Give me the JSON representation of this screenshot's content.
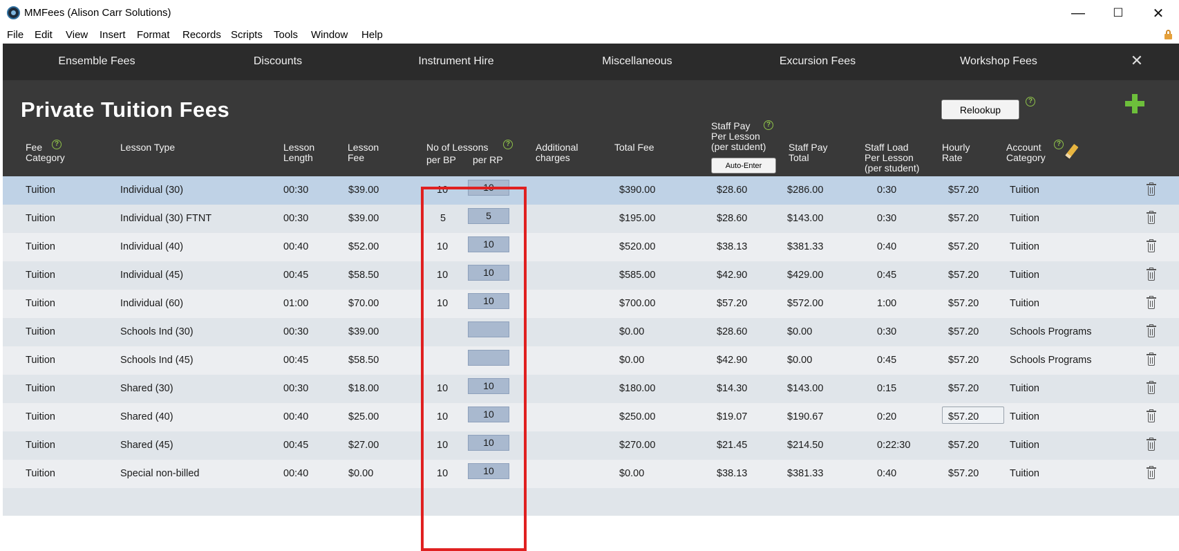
{
  "window": {
    "title": "MMFees (Alison Carr Solutions)",
    "minimize": "—",
    "maximize": "☐",
    "close": "✕"
  },
  "menu": [
    "File",
    "Edit",
    "View",
    "Insert",
    "Format",
    "Records",
    "Scripts",
    "Tools",
    "Window",
    "Help"
  ],
  "tabs": [
    "Ensemble Fees",
    "Discounts",
    "Instrument Hire",
    "Miscellaneous",
    "Excursion Fees",
    "Workshop Fees"
  ],
  "tab_close": "✕",
  "page_title": "Private Tuition Fees",
  "relookup_label": "Relookup",
  "help_glyph": "?",
  "headers": {
    "fee_category": "Fee\nCategory",
    "lesson_type": "Lesson Type",
    "lesson_length": "Lesson\nLength",
    "lesson_fee": "Lesson\nFee",
    "no_of_lessons": "No of Lessons",
    "per_bp": "per BP",
    "per_rp": "per RP",
    "additional_charges": "Additional\ncharges",
    "total_fee": "Total Fee",
    "staff_pay_per_lesson": "Staff Pay\nPer Lesson\n(per student)",
    "auto_enter": "Auto-Enter",
    "staff_pay_total": "Staff Pay\nTotal",
    "staff_load": "Staff Load\nPer Lesson\n(per student)",
    "hourly_rate": "Hourly\nRate",
    "account_category": "Account\nCategory"
  },
  "rows": [
    {
      "fee_category": "Tuition",
      "lesson_type": "Individual (30)",
      "length": "00:30",
      "fee": "$39.00",
      "bp": "10",
      "rp": "10",
      "total": "$390.00",
      "staff_pay": "$28.60",
      "staff_total": "$286.00",
      "load": "0:30",
      "rate": "$57.20",
      "account": "Tuition"
    },
    {
      "fee_category": "Tuition",
      "lesson_type": "Individual (30) FTNT",
      "length": "00:30",
      "fee": "$39.00",
      "bp": "5",
      "rp": "5",
      "total": "$195.00",
      "staff_pay": "$28.60",
      "staff_total": "$143.00",
      "load": "0:30",
      "rate": "$57.20",
      "account": "Tuition"
    },
    {
      "fee_category": "Tuition",
      "lesson_type": "Individual (40)",
      "length": "00:40",
      "fee": "$52.00",
      "bp": "10",
      "rp": "10",
      "total": "$520.00",
      "staff_pay": "$38.13",
      "staff_total": "$381.33",
      "load": "0:40",
      "rate": "$57.20",
      "account": "Tuition"
    },
    {
      "fee_category": "Tuition",
      "lesson_type": "Individual (45)",
      "length": "00:45",
      "fee": "$58.50",
      "bp": "10",
      "rp": "10",
      "total": "$585.00",
      "staff_pay": "$42.90",
      "staff_total": "$429.00",
      "load": "0:45",
      "rate": "$57.20",
      "account": "Tuition"
    },
    {
      "fee_category": "Tuition",
      "lesson_type": "Individual (60)",
      "length": "01:00",
      "fee": "$70.00",
      "bp": "10",
      "rp": "10",
      "total": "$700.00",
      "staff_pay": "$57.20",
      "staff_total": "$572.00",
      "load": "1:00",
      "rate": "$57.20",
      "account": "Tuition"
    },
    {
      "fee_category": "Tuition",
      "lesson_type": "Schools Ind (30)",
      "length": "00:30",
      "fee": "$39.00",
      "bp": "",
      "rp": "",
      "total": "$0.00",
      "staff_pay": "$28.60",
      "staff_total": "$0.00",
      "load": "0:30",
      "rate": "$57.20",
      "account": "Schools Programs"
    },
    {
      "fee_category": "Tuition",
      "lesson_type": "Schools Ind (45)",
      "length": "00:45",
      "fee": "$58.50",
      "bp": "",
      "rp": "",
      "total": "$0.00",
      "staff_pay": "$42.90",
      "staff_total": "$0.00",
      "load": "0:45",
      "rate": "$57.20",
      "account": "Schools Programs"
    },
    {
      "fee_category": "Tuition",
      "lesson_type": "Shared (30)",
      "length": "00:30",
      "fee": "$18.00",
      "bp": "10",
      "rp": "10",
      "total": "$180.00",
      "staff_pay": "$14.30",
      "staff_total": "$143.00",
      "load": "0:15",
      "rate": "$57.20",
      "account": "Tuition"
    },
    {
      "fee_category": "Tuition",
      "lesson_type": "Shared (40)",
      "length": "00:40",
      "fee": "$25.00",
      "bp": "10",
      "rp": "10",
      "total": "$250.00",
      "staff_pay": "$19.07",
      "staff_total": "$190.67",
      "load": "0:20",
      "rate": "$57.20",
      "account": "Tuition"
    },
    {
      "fee_category": "Tuition",
      "lesson_type": "Shared (45)",
      "length": "00:45",
      "fee": "$27.00",
      "bp": "10",
      "rp": "10",
      "total": "$270.00",
      "staff_pay": "$21.45",
      "staff_total": "$214.50",
      "load": "0:22:30",
      "rate": "$57.20",
      "account": "Tuition"
    },
    {
      "fee_category": "Tuition",
      "lesson_type": "Special non-billed",
      "length": "00:40",
      "fee": "$0.00",
      "bp": "10",
      "rp": "10",
      "total": "$0.00",
      "staff_pay": "$38.13",
      "staff_total": "$381.33",
      "load": "0:40",
      "rate": "$57.20",
      "account": "Tuition"
    }
  ],
  "colors": {
    "header_bg": "#393939",
    "tabbar_bg": "#2b2b2b",
    "selected_row": "#bfd2e6",
    "highlight_border": "#e02020",
    "help_icon": "#8fc24a",
    "add_icon": "#6dbf3b"
  }
}
